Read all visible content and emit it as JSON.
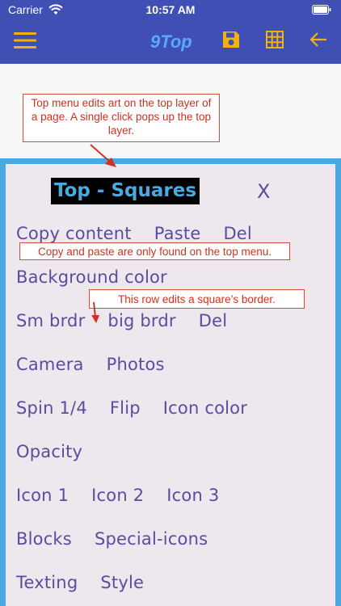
{
  "status_bar": {
    "carrier": "Carrier",
    "time": "10:57 AM"
  },
  "navbar": {
    "title": "9Top",
    "icons": [
      "hamburger-menu-icon",
      "save-icon",
      "grid-icon",
      "back-arrow-icon"
    ],
    "accent_color": "#f2b20a",
    "background_color": "#3f4fb3",
    "title_color": "#5aa7ff"
  },
  "annotations": {
    "top_menu_note": "Top menu edits art on the top layer of a page. A single click pops up the top layer.",
    "copy_paste_note": "Copy and paste are only found on the top menu.",
    "border_row_note": "This row edits a square’s border."
  },
  "panel": {
    "title": "Top - Squares",
    "close_label": "X",
    "rows": [
      [
        "Copy content",
        "Paste",
        "Del"
      ],
      [
        "Background color"
      ],
      [
        "Sm brdr",
        "big brdr",
        "Del"
      ],
      [
        "Camera",
        "Photos"
      ],
      [
        "Spin 1/4",
        "Flip",
        "Icon color"
      ],
      [
        "Opacity"
      ],
      [
        "Icon 1",
        "Icon 2",
        "Icon 3"
      ],
      [
        "Blocks",
        "Special-icons"
      ],
      [
        "Texting",
        "Style"
      ]
    ]
  }
}
